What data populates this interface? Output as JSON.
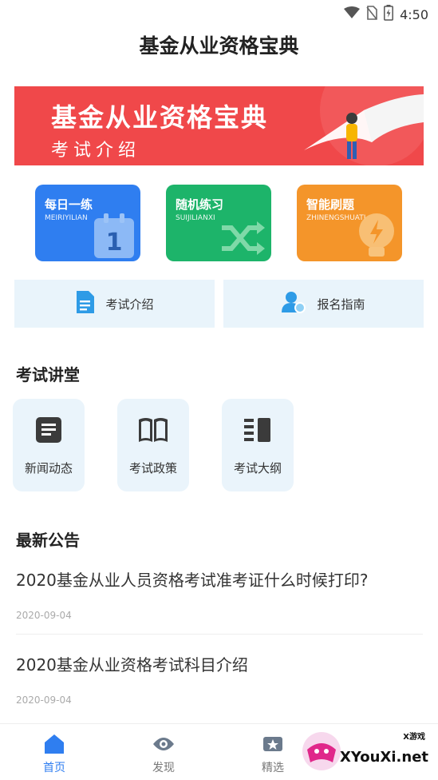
{
  "status": {
    "time": "4:50",
    "icons": [
      "wifi-icon",
      "no-sim-icon",
      "battery-icon"
    ]
  },
  "app": {
    "title": "基金从业资格宝典"
  },
  "banner": {
    "title": "基金从业资格宝典",
    "subtitle": "考试介绍"
  },
  "tiles": [
    {
      "title": "每日一练",
      "subtitle": "MEIRIYILIAN",
      "icon": "calendar-icon",
      "color": "#2f7ef0"
    },
    {
      "title": "随机练习",
      "subtitle": "SUIJILIANXI",
      "icon": "shuffle-icon",
      "color": "#1db46a"
    },
    {
      "title": "智能刷题",
      "subtitle": "ZHINENGSHUATI",
      "icon": "bulb-icon",
      "color": "#f4952a"
    }
  ],
  "guides": [
    {
      "label": "考试介绍",
      "icon": "document-icon"
    },
    {
      "label": "报名指南",
      "icon": "user-settings-icon"
    }
  ],
  "lecture": {
    "title": "考试讲堂",
    "items": [
      {
        "label": "新闻动态",
        "icon": "news-icon"
      },
      {
        "label": "考试政策",
        "icon": "book-icon"
      },
      {
        "label": "考试大纲",
        "icon": "outline-icon"
      }
    ]
  },
  "announcements": {
    "title": "最新公告",
    "items": [
      {
        "title": "2020基金从业人员资格考试准考证什么时候打印?",
        "date": "2020-09-04"
      },
      {
        "title": "2020基金从业资格考试科目介绍",
        "date": "2020-09-04"
      }
    ]
  },
  "tabbar": {
    "items": [
      {
        "label": "首页",
        "icon": "home-icon",
        "active": true
      },
      {
        "label": "发现",
        "icon": "eye-icon",
        "active": false
      },
      {
        "label": "精选",
        "icon": "star-ticket-icon",
        "active": false
      }
    ]
  },
  "watermark": {
    "text": "XYouXi.net",
    "small": "X游戏"
  },
  "colors": {
    "accent": "#2f7ef0",
    "banner": "#f0484a",
    "light_bg": "#e9f4fb"
  }
}
